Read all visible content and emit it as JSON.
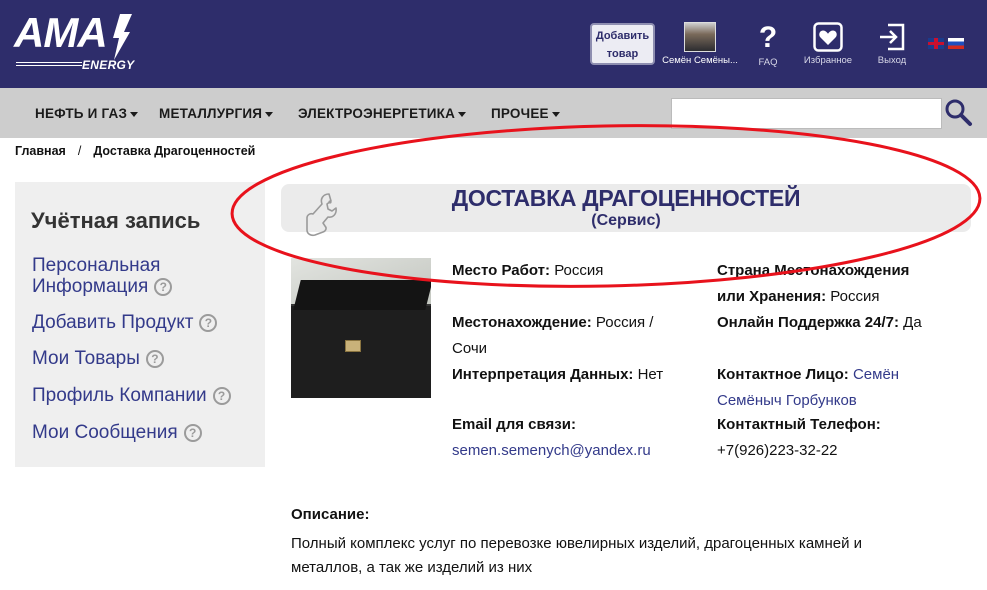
{
  "header": {
    "logo_main": "AMA",
    "logo_sub": "ENERGY",
    "add_button": "Добавить товар",
    "user_name": "Семён Семёны...",
    "faq_label": "FAQ",
    "favorites_label": "Избранное",
    "exit_label": "Выход",
    "flags": [
      "en-flag",
      "ru-flag"
    ],
    "bg_color": "#2e2d6b"
  },
  "nav": {
    "items": [
      "НЕФТЬ И ГАЗ",
      "МЕТАЛЛУРГИЯ",
      "ЭЛЕКТРОЭНЕРГЕТИКА",
      "ПРОЧЕЕ"
    ],
    "search_placeholder": ""
  },
  "breadcrumb": {
    "home": "Главная",
    "separator": "/",
    "current": "Доставка Драгоценностей"
  },
  "sidebar": {
    "title": "Учётная запись",
    "items": [
      {
        "label": "Персональная Информация"
      },
      {
        "label": "Добавить Продукт"
      },
      {
        "label": "Мои Товары"
      },
      {
        "label": "Профиль Компании"
      },
      {
        "label": "Мои Сообщения"
      }
    ],
    "help_glyph": "?"
  },
  "product": {
    "title": "ДОСТАВКА ДРАГОЦЕННОСТЕЙ",
    "subtitle": "(Сервис)",
    "left": {
      "workplace_label": "Место Работ:",
      "workplace_value": "Россия",
      "location_label": "Местонахождение:",
      "location_value_1": "Россия /",
      "location_value_2": "Сочи",
      "interp_label": "Интерпретация Данных:",
      "interp_value": "Нет",
      "email_label": "Email для связи:",
      "email_value": "semen.semenych@yandex.ru"
    },
    "right": {
      "country_label_1": "Страна Местонахождения",
      "country_label_2": "или Хранения:",
      "country_value": "Россия",
      "support_label": "Онлайн Поддержка 24/7:",
      "support_value": "Да",
      "contact_label": "Контактное Лицо:",
      "contact_value_1": "Семён",
      "contact_value_2": "Семёныч Горбунков",
      "phone_label": "Контактный Телефон:",
      "phone_value": "+7(926)223-32-22"
    },
    "description_heading": "Описание:",
    "description_line_1": "Полный комплекс услуг по перевозке ювелирных изделий, драгоценных камней и",
    "description_line_2": "металлов, а так же изделий из них"
  },
  "colors": {
    "accent": "#2e2d6b",
    "link": "#333a8a",
    "nav_bg": "#cdcdcd",
    "annotation_red": "#e8121c"
  }
}
